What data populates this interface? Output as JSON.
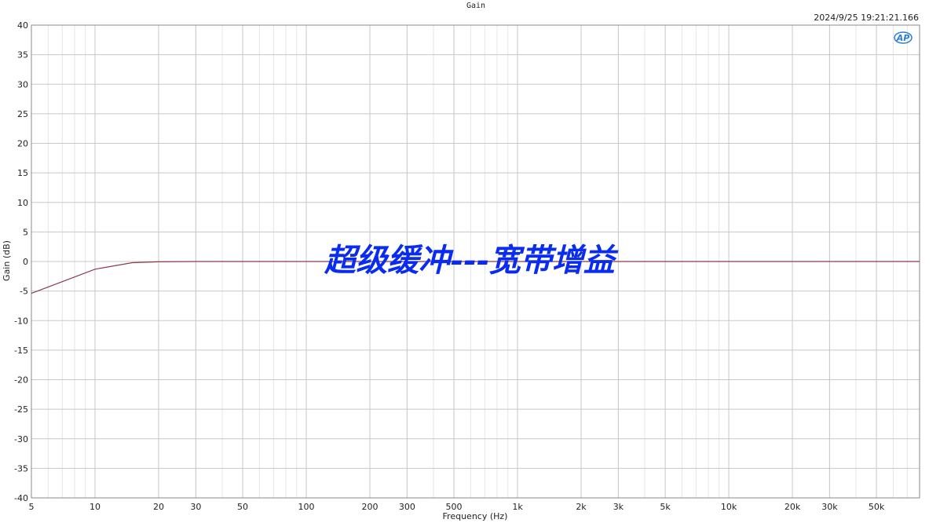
{
  "chart_data": {
    "type": "line",
    "title": "Gain",
    "timestamp": "2024/9/25 19:21:21.166",
    "xlabel": "Frequency (Hz)",
    "ylabel": "Gain (dB)",
    "x_scale": "log",
    "xlim": [
      5,
      80000
    ],
    "ylim": [
      -40,
      40
    ],
    "grid": true,
    "x_ticks": [
      5,
      10,
      20,
      30,
      50,
      100,
      200,
      300,
      500,
      1000,
      2000,
      3000,
      5000,
      10000,
      20000,
      30000,
      50000
    ],
    "x_tick_labels": [
      "5",
      "10",
      "20",
      "30",
      "50",
      "100",
      "200",
      "300",
      "500",
      "1k",
      "2k",
      "3k",
      "5k",
      "10k",
      "20k",
      "30k",
      "50k"
    ],
    "y_ticks": [
      40,
      35,
      30,
      25,
      20,
      15,
      10,
      5,
      0,
      -5,
      -10,
      -15,
      -20,
      -25,
      -30,
      -35,
      -40
    ],
    "y_tick_labels": [
      "40",
      "35",
      "30",
      "25",
      "20",
      "15",
      "10",
      "5",
      "0",
      "-5",
      "-10",
      "-15",
      "-20",
      "-25",
      "-30",
      "-35",
      "-40"
    ],
    "series": [
      {
        "color": "#8b3a4a",
        "x": [
          5,
          10,
          15,
          20,
          30,
          50,
          100,
          1000,
          10000,
          80000
        ],
        "y": [
          -5.4,
          -1.3,
          -0.2,
          -0.05,
          0,
          0,
          0,
          0,
          0,
          0
        ]
      }
    ],
    "annotation": "超级缓冲---宽带增益",
    "logo": "AP"
  },
  "colors": {
    "grid": "#c8c8c8",
    "frame": "#8a8a8a",
    "annotation": "#0a2cf0"
  }
}
